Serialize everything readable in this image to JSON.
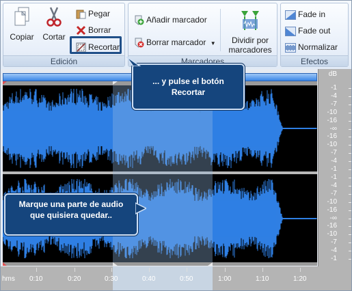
{
  "ribbon": {
    "edit_group": {
      "label": "Edición",
      "copy": "Copiar",
      "cut": "Cortar",
      "paste": "Pegar",
      "delete": "Borrar",
      "trim": "Recortar"
    },
    "markers_group": {
      "label": "Marcadores",
      "add_marker": "Añadir marcador",
      "delete_marker": "Borrar marcador",
      "split_line1": "Dividir por",
      "split_line2": "marcadores"
    },
    "effects_group": {
      "label": "Efectos",
      "fade_in": "Fade in",
      "fade_out": "Fade out",
      "normalize": "Normalizar"
    }
  },
  "db_scale": {
    "unit": "dB",
    "channel_1": [
      "-1",
      "-4",
      "-7",
      "-10",
      "-16",
      "-∞",
      "-16",
      "-10",
      "-7",
      "-4",
      "-1"
    ],
    "channel_2": [
      "-1",
      "-4",
      "-7",
      "-10",
      "-16",
      "-∞",
      "-16",
      "-10",
      "-7",
      "-4",
      "-1"
    ]
  },
  "timeline": {
    "labels": [
      "hms",
      "0:10",
      "0:20",
      "0:30",
      "0:40",
      "0:50",
      "1:00",
      "1:10",
      "1:20"
    ]
  },
  "callouts": {
    "trim_line1": "... y pulse el botón",
    "trim_line2": "Recortar",
    "select_line1": "Marque una parte de audio",
    "select_line2": "que quisiera quedar.."
  },
  "colors": {
    "wave": "#2f7fe3",
    "wave_dark": "#1b4f9c",
    "callout_bg": "#15457d",
    "highlight_border": "#1f4f88"
  }
}
